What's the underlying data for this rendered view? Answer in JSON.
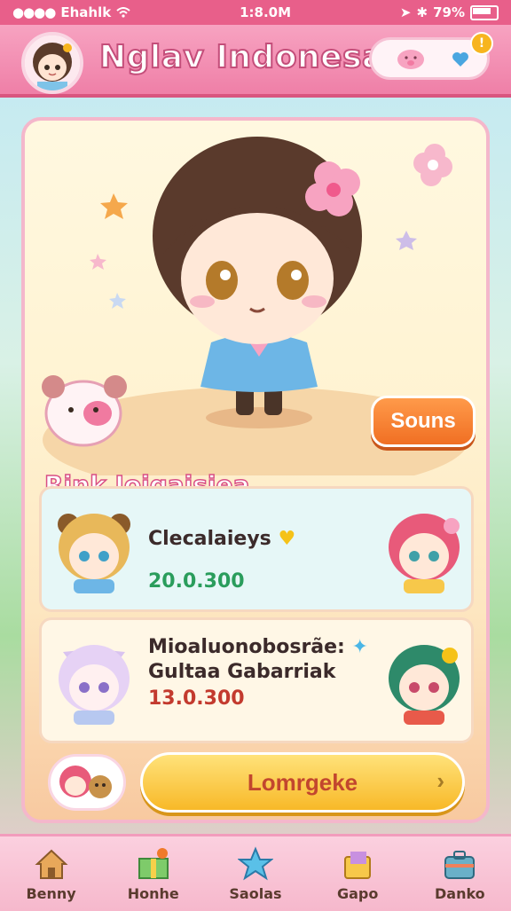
{
  "status_bar": {
    "carrier": "Ehahlk",
    "time": "1:8.0M",
    "battery": "79%"
  },
  "header": {
    "title": "Nglav Indonesai",
    "notification_badge": "!"
  },
  "stage": {
    "sound_button": "Souns"
  },
  "ranking": {
    "title": "Rink Ioigaisiea",
    "entries": [
      {
        "name": "Clecalaieys",
        "score": "20.0.300",
        "score_color": "#2a9d5c"
      },
      {
        "name_line1": "Mioaluonobosrãe:",
        "name_line2": "Gultaa Gabarriak",
        "score": "13.0.300",
        "score_color": "#c33a2e"
      }
    ]
  },
  "primary_button": {
    "label": "Lomrgeke"
  },
  "tab_bar": {
    "tabs": [
      {
        "label": "Benny",
        "icon": "house-icon"
      },
      {
        "label": "Honhe",
        "icon": "gift-box-icon"
      },
      {
        "label": "Saolas",
        "icon": "star-icon"
      },
      {
        "label": "Gapo",
        "icon": "shopping-bag-icon"
      },
      {
        "label": "Danko",
        "icon": "toolbox-icon"
      }
    ]
  },
  "colors": {
    "accent": "#e85f8a",
    "button_orange": "#f06f23",
    "button_yellow": "#f8b928"
  }
}
